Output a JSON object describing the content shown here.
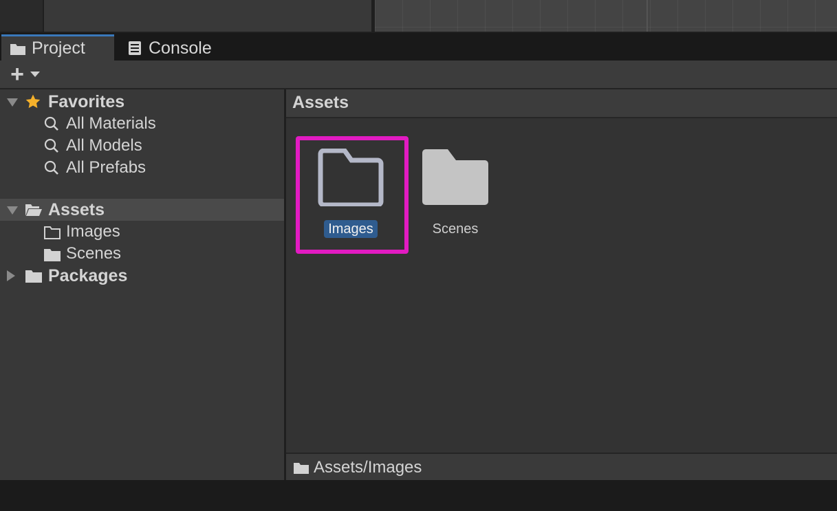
{
  "tabs": {
    "project_label": "Project",
    "console_label": "Console"
  },
  "toolbar": {
    "add_symbol": "+"
  },
  "tree": {
    "favorites": {
      "label": "Favorites",
      "items": [
        "All Materials",
        "All Models",
        "All Prefabs"
      ]
    },
    "assets": {
      "label": "Assets",
      "children": [
        "Images",
        "Scenes"
      ]
    },
    "packages": {
      "label": "Packages"
    }
  },
  "content": {
    "header": "Assets",
    "items": [
      {
        "name": "Images",
        "icon": "folder-outline-icon",
        "selected": true
      },
      {
        "name": "Scenes",
        "icon": "folder-filled-icon",
        "selected": false
      }
    ]
  },
  "status": {
    "path": "Assets/Images"
  },
  "colors": {
    "accent": "#3a79bb",
    "selection": "#2f5c8f",
    "highlight_box": "#e21bc2",
    "star": "#f5b12b"
  }
}
